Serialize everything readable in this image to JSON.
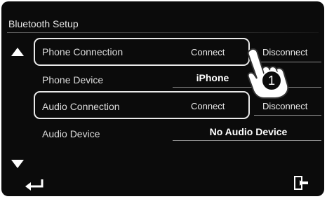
{
  "screen": {
    "title": "Bluetooth Setup"
  },
  "rows": [
    {
      "label": "Phone Connection",
      "connect": "Connect",
      "disconnect": "Disconnect"
    },
    {
      "label": "Phone Device",
      "value": "iPhone"
    },
    {
      "label": "Audio Connection",
      "connect": "Connect",
      "disconnect": "Disconnect"
    },
    {
      "label": "Audio Device",
      "value": "No Audio Device"
    }
  ],
  "annotation": {
    "step": "1"
  },
  "icons": {
    "scroll_up": "triangle-up-icon",
    "scroll_down": "triangle-down-icon",
    "back": "return-arrow-icon",
    "exit": "exit-door-icon",
    "pointer": "hand-pointer-icon"
  }
}
